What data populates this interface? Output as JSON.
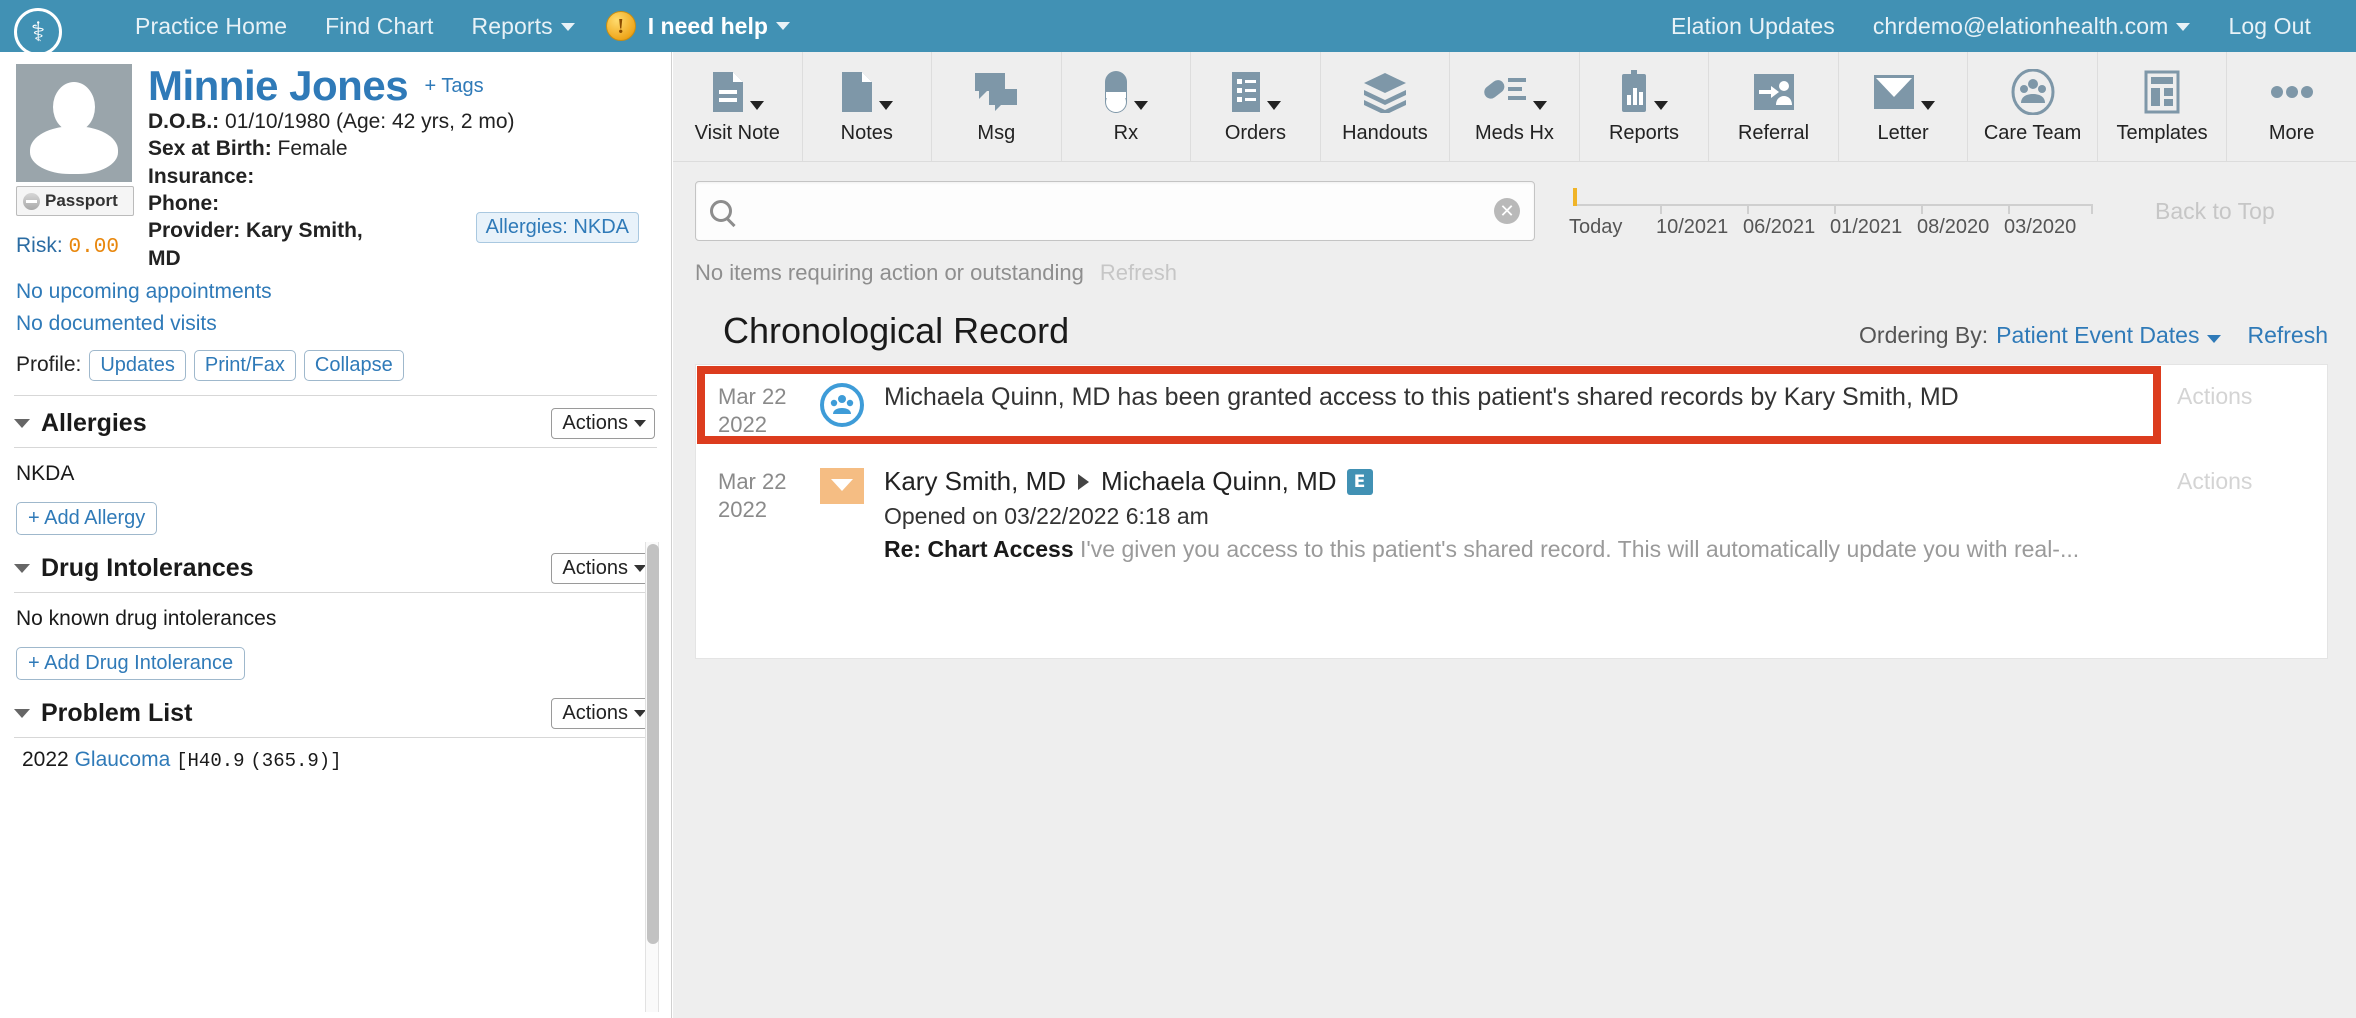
{
  "topnav": {
    "logo_glyph": "⚕",
    "links": [
      {
        "label": "Practice Home",
        "caret": false
      },
      {
        "label": "Find Chart",
        "caret": false
      },
      {
        "label": "Reports",
        "caret": true
      }
    ],
    "help_label": "I need help",
    "help_icon": "warning-icon",
    "right_links": [
      {
        "label": "Elation Updates",
        "caret": false
      },
      {
        "label": "chrdemo@elationhealth.com",
        "caret": true
      },
      {
        "label": "Log Out",
        "caret": false
      }
    ],
    "background_color": "#4191b4"
  },
  "patient": {
    "name": "Minnie Jones",
    "tags_label": "+ Tags",
    "passport_label": "Passport",
    "risk_label": "Risk:",
    "risk_value": "0.00",
    "dob_label": "D.O.B.:",
    "dob_value": "01/10/1980 (Age: 42 yrs, 2 mo)",
    "sex_label": "Sex at Birth:",
    "sex_value": "Female",
    "insurance_label": "Insurance:",
    "insurance_value": "",
    "phone_label": "Phone:",
    "phone_value": "",
    "provider_label": "Provider: Kary Smith,",
    "provider_label2": "MD",
    "allergy_chip": "Allergies: NKDA",
    "no_appointments": "No upcoming appointments",
    "no_visits": "No documented visits",
    "profile_label": "Profile:",
    "profile_buttons": [
      "Updates",
      "Print/Fax",
      "Collapse"
    ]
  },
  "sidebar_sections": [
    {
      "title": "Allergies",
      "actions_label": "Actions",
      "content": "NKDA",
      "add_label": "+ Add Allergy"
    },
    {
      "title": "Drug Intolerances",
      "actions_label": "Actions",
      "content": "No known drug intolerances",
      "add_label": "+ Add Drug Intolerance"
    },
    {
      "title": "Problem List",
      "actions_label": "Actions",
      "problems": [
        {
          "year": "2022",
          "name": "Glaucoma",
          "code": "[H40.9",
          "alt_code": "(365.9)]"
        }
      ]
    }
  ],
  "toolbar": [
    {
      "label": "Visit Note",
      "icon": "document-lines-icon",
      "caret": true
    },
    {
      "label": "Notes",
      "icon": "page-corner-icon",
      "caret": true
    },
    {
      "label": "Msg",
      "icon": "chat-bubbles-icon",
      "caret": false
    },
    {
      "label": "Rx",
      "icon": "pill-capsule-icon",
      "caret": true
    },
    {
      "label": "Orders",
      "icon": "list-clipboard-icon",
      "caret": true
    },
    {
      "label": "Handouts",
      "icon": "stacked-layers-icon",
      "caret": false
    },
    {
      "label": "Meds Hx",
      "icon": "pill-list-icon",
      "caret": true
    },
    {
      "label": "Reports",
      "icon": "chart-clipboard-icon",
      "caret": true
    },
    {
      "label": "Referral",
      "icon": "person-arrow-icon",
      "caret": false
    },
    {
      "label": "Letter",
      "icon": "envelope-icon",
      "caret": true
    },
    {
      "label": "Care Team",
      "icon": "people-circle-icon",
      "caret": false
    },
    {
      "label": "Templates",
      "icon": "template-grid-icon",
      "caret": false
    },
    {
      "label": "More",
      "icon": "ellipsis-icon",
      "caret": false
    }
  ],
  "search": {
    "value": "",
    "placeholder": "",
    "icon": "search-icon",
    "clear_icon": "clear-circle-icon"
  },
  "timeline": {
    "labels": [
      "Today",
      "10/2021",
      "06/2021",
      "01/2021",
      "08/2020",
      "03/2020"
    ],
    "marker_color": "#f0b428",
    "back_to_top": "Back to Top"
  },
  "status": {
    "text": "No items requiring action or outstanding",
    "refresh": "Refresh"
  },
  "record_header": {
    "title": "Chronological Record",
    "ordering_label": "Ordering By:",
    "ordering_value": "Patient Event Dates",
    "refresh": "Refresh"
  },
  "records": [
    {
      "date_day": "Mar 22",
      "date_year": "2022",
      "icon": "care-team-circle-icon",
      "text": "Michaela Quinn, MD has been granted access to this patient's shared records by Kary Smith, MD",
      "actions_label": "Actions",
      "highlighted": true,
      "highlight_color": "#dc3c1e"
    },
    {
      "date_day": "Mar 22",
      "date_year": "2022",
      "icon": "envelope-icon",
      "from": "Kary Smith, MD",
      "to": "Michaela Quinn, MD",
      "badge": "elation-e-badge",
      "opened": "Opened on 03/22/2022 6:18 am",
      "subject": "Re: Chart Access",
      "snippet": "I've given you access to this patient's shared record. This will automatically update you with real-...",
      "actions_label": "Actions",
      "highlighted": false
    }
  ]
}
